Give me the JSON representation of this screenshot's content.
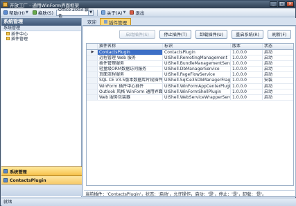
{
  "window": {
    "title": "开放工厂 - 通用WinForm界面框架",
    "buttons": [
      "_",
      "□",
      "×"
    ]
  },
  "toolbar": {
    "help_label": "帮助(H)",
    "theme_label": "换肤(S)",
    "theme_value": "Office 2003 银色",
    "about_label": "关于(A)",
    "exit_label": "退出"
  },
  "sidebar": {
    "header": "系统管理",
    "group_label": "系统管理",
    "items": [
      {
        "label": "插件中心",
        "icon": "folder-icon"
      },
      {
        "label": "插件管理",
        "icon": "folder-icon"
      }
    ],
    "panels": [
      {
        "label": "系统管理",
        "active": true
      },
      {
        "label": "ContactsPlugin",
        "active": false
      }
    ]
  },
  "tabs": [
    {
      "label": "欢迎",
      "active": false
    },
    {
      "label": "插件管理",
      "active": true
    }
  ],
  "actions": {
    "start": "启动插件(S)",
    "stop": "停止插件(T)",
    "unload": "卸载插件(U)",
    "restart": "重启系统(R)",
    "refresh": "刷新(F)"
  },
  "grid": {
    "columns": [
      "插件名称",
      "标识",
      "版本",
      "状态"
    ],
    "rows": [
      {
        "name": "ContactsPlugin",
        "id": "ContactsPlugin",
        "version": "1.0.0.0",
        "state": "启动",
        "selected": true
      },
      {
        "name": "远程管理 Web 服务",
        "id": "UIShell.RemotingManagement",
        "version": "1.0.0.0",
        "state": "启动",
        "selected": false
      },
      {
        "name": "插件管理服务",
        "id": "UIShell.BundleManagementService",
        "version": "1.0.0.0",
        "state": "启动",
        "selected": false
      },
      {
        "name": "轻量级ORM数据访问服务",
        "id": "UIShell.DbManagerService",
        "version": "1.0.0.0",
        "state": "启动",
        "selected": false
      },
      {
        "name": "页面流程服务",
        "id": "UIShell.PageFlowService",
        "version": "1.0.0.0",
        "state": "启动",
        "selected": false
      },
      {
        "name": "SQL CE V3.5版本数据库片段插件",
        "id": "UIShell.SqlCe35DbManagerFragment",
        "version": "1.0.0.0",
        "state": "安装",
        "selected": false
      },
      {
        "name": "WinForm 插件中心插件",
        "id": "UIShell.WinFormAppCenterPlugin",
        "version": "1.0.0.0",
        "state": "启动",
        "selected": false
      },
      {
        "name": "Outlook 风格 WinForm 通用界面框架...",
        "id": "UIShell.WinFormShellPlugin",
        "version": "1.0.0.0",
        "state": "启动",
        "selected": false
      },
      {
        "name": "Web 服务包装器",
        "id": "UIShell.WebServiceWrapperService",
        "version": "1.0.0.0",
        "state": "启动",
        "selected": false
      }
    ]
  },
  "status_line": "当前插件：'ContactsPlugin'，状态：'启动'，允许操作，启动：'是'，停止：'是'，卸载：'是'。",
  "statusbar": "就绪"
}
